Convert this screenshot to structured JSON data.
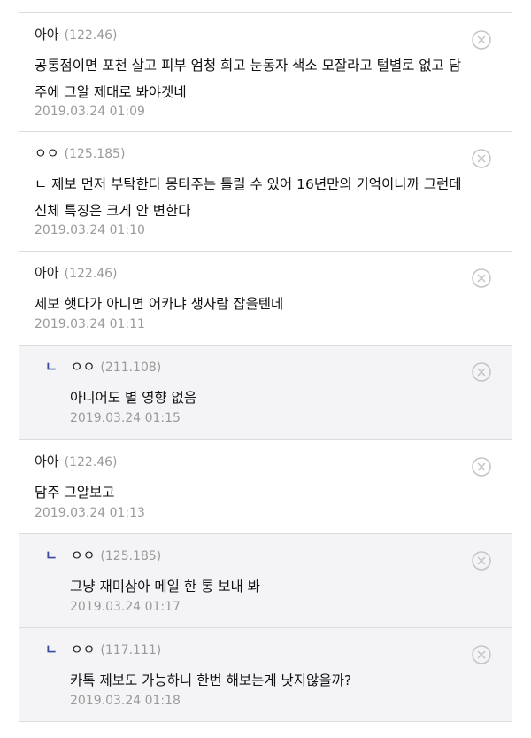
{
  "comments": [
    {
      "reply": false,
      "author": "아아",
      "ip": "(122.46)",
      "text": "공통점이면 포천 살고 피부 엄청 희고 눈동자 색소 모잘라고 털별로 없고 담주에 그알 제대로 봐야겟네",
      "time": "2019.03.24 01:09"
    },
    {
      "reply": false,
      "author": "ㅇㅇ",
      "ip": "(125.185)",
      "text": "ㄴ 제보 먼저 부탁한다 몽타주는 틀릴 수 있어 16년만의 기억이니까 그런데 신체 특징은 크게 안 변한다",
      "time": "2019.03.24 01:10"
    },
    {
      "reply": false,
      "author": "아아",
      "ip": "(122.46)",
      "text": "제보 햇다가 아니면 어카냐 생사람 잡을텐데",
      "time": "2019.03.24 01:11"
    },
    {
      "reply": true,
      "author": "ㅇㅇ",
      "ip": "(211.108)",
      "text": "아니어도 별 영향 없음",
      "time": "2019.03.24 01:15"
    },
    {
      "reply": false,
      "author": "아아",
      "ip": "(122.46)",
      "text": "담주 그알보고",
      "time": "2019.03.24 01:13"
    },
    {
      "reply": true,
      "author": "ㅇㅇ",
      "ip": "(125.185)",
      "text": "그냥 재미삼아 메일 한 통 보내 봐",
      "time": "2019.03.24 01:17"
    },
    {
      "reply": true,
      "author": "ㅇㅇ",
      "ip": "(117.111)",
      "text": "카톡 제보도 가능하니 한번 해보는게 낫지않을까?",
      "time": "2019.03.24 01:18"
    }
  ],
  "reply_marker": "ㄴ",
  "icons": {
    "delete": "circle-x-icon",
    "reply": "reply-arrow-icon"
  },
  "colors": {
    "reply_marker": "#3a4aa0",
    "meta": "#9a9a9a",
    "reply_bg": "#f4f4f6",
    "divider": "#dcdcdc"
  }
}
